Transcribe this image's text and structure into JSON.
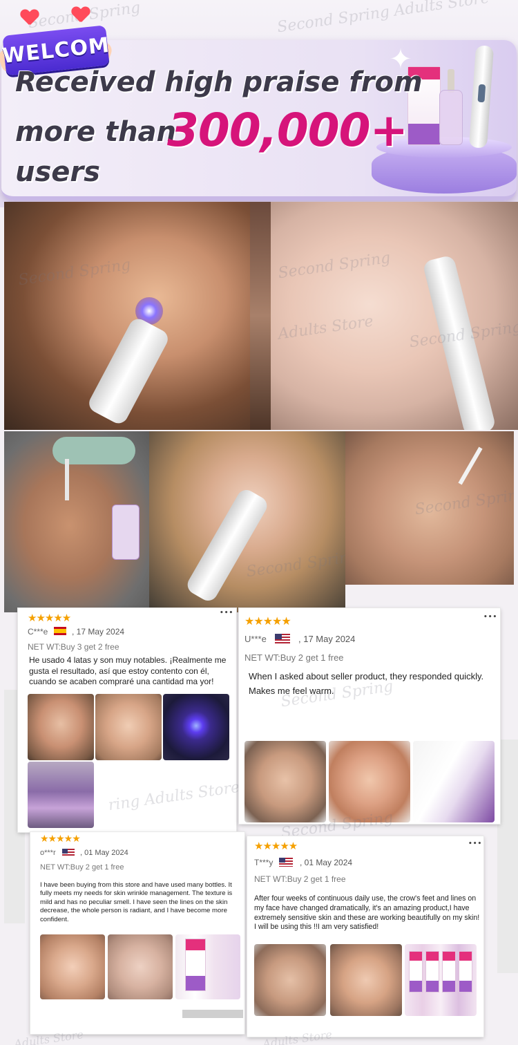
{
  "banner": {
    "welcome_sign": "WELCOM",
    "line1": "Received high praise from",
    "line2": "more than",
    "count": "300,000+",
    "line3": "users"
  },
  "watermark": {
    "text1": "Second Spring Adults Store",
    "text2": "Second Spring",
    "text3": "Adults Store",
    "text4": "Second Spring Adults Store",
    "text5": "ring Adults Store"
  },
  "photos": [
    {
      "name": "woman-using-blue-light-pen"
    },
    {
      "name": "woman-applying-white-pen"
    },
    {
      "name": "woman-applying-dropper-serum"
    },
    {
      "name": "woman-holding-pen"
    },
    {
      "name": "woman-applying-dropper-close-up"
    }
  ],
  "reviews": [
    {
      "stars": "★★★★★",
      "more": "•••",
      "name": "C***e",
      "flag": "es",
      "date": ", 17 May 2024",
      "net": "NET WT:Buy 3 get 2 free",
      "text": "He usado 4 latas y son muy notables. ¡Realmente me gusta el resultado, así que estoy contento con él, cuando se acaben compraré una cantidad ma yor!"
    },
    {
      "stars": "★★★★★",
      "more": "•••",
      "name": "U***e",
      "flag": "us",
      "date": ", 17 May 2024",
      "net": "NET WT:Buy 2 get 1 free",
      "text": "When I asked about seller product, they responded quickly. Makes me feel warm."
    },
    {
      "stars": "★★★★★",
      "more": "",
      "name": "o***r",
      "flag": "us",
      "date": ", 01 May 2024",
      "net": "NET WT:Buy 2 get 1 free",
      "text": "I have been buying from this store and have used many bottles. It fully meets my needs for skin wrinkle management. The texture is mild and has no peculiar smell. I have seen the lines on the skin decrease, the whole person is radiant, and I have become more confident."
    },
    {
      "stars": "★★★★★",
      "more": "•••",
      "name": "T***y",
      "flag": "us",
      "date": ", 01 May 2024",
      "net": "NET WT:Buy 2 get 1 free",
      "text": "After four weeks of continuous daily use, the crow's feet and lines on my face have changed dramatically, it's an amazing product,I have extremely sensitive skin and these are working beautifully on my skin! I will be using this !!I am very satisfied!"
    }
  ],
  "colors": {
    "accent": "#d6147a",
    "star": "#f5a000",
    "welcome_sign": "#5a33e0",
    "banner_bg": "#ece6f2"
  },
  "icons": [
    "heart-icon",
    "sparkle-icon",
    "star-icon",
    "more-icon",
    "flag-es-icon",
    "flag-us-icon"
  ]
}
